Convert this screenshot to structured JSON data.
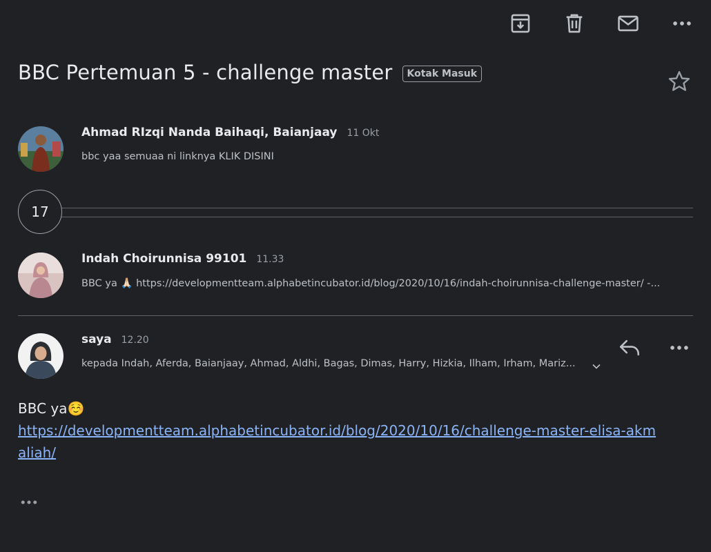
{
  "toolbar": {
    "archive_icon": "archive-icon",
    "delete_icon": "trash-icon",
    "mark_unread_icon": "mail-icon",
    "more_icon": "more-horizontal-icon"
  },
  "thread": {
    "subject": "BBC Pertemuan 5 - challenge master",
    "label": "Kotak Masuk",
    "star_icon": "star-outline-icon"
  },
  "messages": [
    {
      "sender": "Ahmad RIzqi Nanda Baihaqi, Baianjaay",
      "time": "11 Okt",
      "snippet": "bbc yaa semuaa ni linknya KLIK DISINI"
    },
    {
      "sender": "Indah Choirunnisa 99101",
      "time": "11.33",
      "snippet": "BBC ya 🙏🏻 https://developmentteam.alphabetincubator.id/blog/2020/10/16/indah-choirunnisa-challenge-master/ -..."
    },
    {
      "sender": "saya",
      "time": "12.20",
      "recipients": "kepada Indah, Aferda, Baianjaay, Ahmad, Aldhi, Bagas, Dimas, Harry, Hizkia, Ilham, Irham, Mariz..."
    }
  ],
  "collapsed_count": "17",
  "body": {
    "text": "BBC ya☺️",
    "link": "https://developmentteam.alphabetincubator.id/blog/2020/10/16/challenge-master-elisa-akmaliah/"
  },
  "colors": {
    "background": "#202124",
    "text": "#e8eaed",
    "secondary_text": "#bdc1c6",
    "link": "#8ab4f8",
    "divider": "#5f6368"
  }
}
